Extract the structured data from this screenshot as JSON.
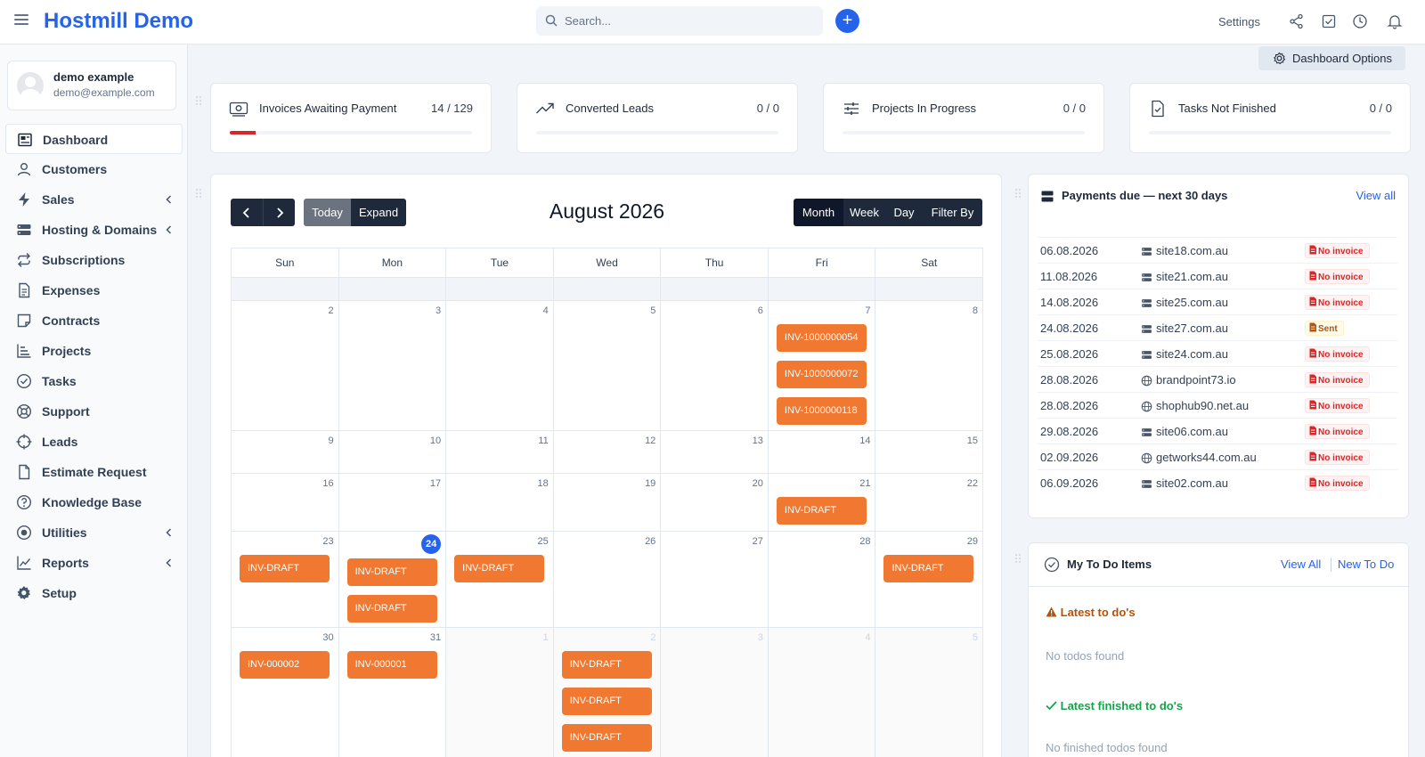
{
  "header": {
    "brand": "Hostmill Demo",
    "search_placeholder": "Search...",
    "add_label": "+",
    "settings_label": "Settings"
  },
  "profile": {
    "name": "demo example",
    "email": "demo@example.com"
  },
  "sidebar": {
    "items": [
      {
        "label": "Dashboard",
        "icon": "dashboard-icon",
        "active": true
      },
      {
        "label": "Customers",
        "icon": "user-icon"
      },
      {
        "label": "Sales",
        "icon": "bolt-icon",
        "chevron": true
      },
      {
        "label": "Hosting & Domains",
        "icon": "server-icon",
        "chevron": true
      },
      {
        "label": "Subscriptions",
        "icon": "repeat-icon"
      },
      {
        "label": "Expenses",
        "icon": "file-text-icon"
      },
      {
        "label": "Contracts",
        "icon": "sticky-note-icon"
      },
      {
        "label": "Projects",
        "icon": "bar-chart-icon"
      },
      {
        "label": "Tasks",
        "icon": "check-circle-icon"
      },
      {
        "label": "Support",
        "icon": "life-buoy-icon"
      },
      {
        "label": "Leads",
        "icon": "crosshair-icon"
      },
      {
        "label": "Estimate Request",
        "icon": "file-icon"
      },
      {
        "label": "Knowledge Base",
        "icon": "help-circle-icon"
      },
      {
        "label": "Utilities",
        "icon": "target-icon",
        "chevron": true
      },
      {
        "label": "Reports",
        "icon": "line-chart-icon",
        "chevron": true
      },
      {
        "label": "Setup",
        "icon": "gear-icon"
      }
    ]
  },
  "dashboard_options_label": "Dashboard Options",
  "stats": [
    {
      "label": "Invoices Awaiting Payment",
      "value": "14 / 129",
      "progress": 0.108
    },
    {
      "label": "Converted Leads",
      "value": "0 / 0",
      "progress": 0
    },
    {
      "label": "Projects In Progress",
      "value": "0 / 0",
      "progress": 0
    },
    {
      "label": "Tasks Not Finished",
      "value": "0 / 0",
      "progress": 0
    }
  ],
  "calendar": {
    "title": "August 2026",
    "today_label": "Today",
    "expand_label": "Expand",
    "views": [
      "Month",
      "Week",
      "Day",
      "Filter By"
    ],
    "weekdays": [
      "Sun",
      "Mon",
      "Tue",
      "Wed",
      "Thu",
      "Fri",
      "Sat"
    ],
    "weeks": [
      [
        {
          "n": "2"
        },
        {
          "n": "3"
        },
        {
          "n": "4"
        },
        {
          "n": "5"
        },
        {
          "n": "6"
        },
        {
          "n": "7",
          "events": [
            "INV-1000000054",
            "INV-1000000072",
            "INV-1000000118"
          ]
        },
        {
          "n": "8"
        }
      ],
      [
        {
          "n": "9"
        },
        {
          "n": "10"
        },
        {
          "n": "11"
        },
        {
          "n": "12"
        },
        {
          "n": "13"
        },
        {
          "n": "14"
        },
        {
          "n": "15"
        }
      ],
      [
        {
          "n": "16"
        },
        {
          "n": "17"
        },
        {
          "n": "18"
        },
        {
          "n": "19"
        },
        {
          "n": "20"
        },
        {
          "n": "21",
          "events": [
            "INV-DRAFT"
          ]
        },
        {
          "n": "22"
        }
      ],
      [
        {
          "n": "23",
          "events": [
            "INV-DRAFT"
          ]
        },
        {
          "n": "24",
          "today": true,
          "events": [
            "INV-DRAFT",
            "INV-DRAFT"
          ]
        },
        {
          "n": "25",
          "events": [
            "INV-DRAFT"
          ]
        },
        {
          "n": "26"
        },
        {
          "n": "27"
        },
        {
          "n": "28"
        },
        {
          "n": "29",
          "events": [
            "INV-DRAFT"
          ]
        }
      ],
      [
        {
          "n": "30",
          "events": [
            "INV-000002"
          ]
        },
        {
          "n": "31",
          "events": [
            "INV-000001"
          ]
        },
        {
          "n": "1",
          "other": true
        },
        {
          "n": "2",
          "other": true,
          "events": [
            "INV-DRAFT",
            "INV-DRAFT",
            "INV-DRAFT"
          ]
        },
        {
          "n": "3",
          "other": true
        },
        {
          "n": "4",
          "other": true
        },
        {
          "n": "5",
          "other": true
        }
      ]
    ]
  },
  "payments": {
    "title": "Payments due — next 30 days",
    "view_all": "View all",
    "rows": [
      {
        "date": "06.08.2026",
        "site": "site18.com.au",
        "icon": "server-icon",
        "status": "No invoice",
        "kind": "noinv"
      },
      {
        "date": "11.08.2026",
        "site": "site21.com.au",
        "icon": "server-icon",
        "status": "No invoice",
        "kind": "noinv"
      },
      {
        "date": "14.08.2026",
        "site": "site25.com.au",
        "icon": "server-icon",
        "status": "No invoice",
        "kind": "noinv"
      },
      {
        "date": "24.08.2026",
        "site": "site27.com.au",
        "icon": "server-icon",
        "status": "Sent",
        "kind": "sent"
      },
      {
        "date": "25.08.2026",
        "site": "site24.com.au",
        "icon": "server-icon",
        "status": "No invoice",
        "kind": "noinv"
      },
      {
        "date": "28.08.2026",
        "site": "brandpoint73.io",
        "icon": "globe-icon",
        "status": "No invoice",
        "kind": "noinv"
      },
      {
        "date": "28.08.2026",
        "site": "shophub90.net.au",
        "icon": "globe-icon",
        "status": "No invoice",
        "kind": "noinv"
      },
      {
        "date": "29.08.2026",
        "site": "site06.com.au",
        "icon": "server-icon",
        "status": "No invoice",
        "kind": "noinv"
      },
      {
        "date": "02.09.2026",
        "site": "getworks44.com.au",
        "icon": "globe-icon",
        "status": "No invoice",
        "kind": "noinv"
      },
      {
        "date": "06.09.2026",
        "site": "site02.com.au",
        "icon": "server-icon",
        "status": "No invoice",
        "kind": "noinv"
      }
    ]
  },
  "todo": {
    "title": "My To Do Items",
    "view_all": "View All",
    "new_todo": "New To Do",
    "latest": "Latest to do's",
    "no_todos": "No todos found",
    "finished": "Latest finished to do's",
    "no_finished": "No finished todos found"
  }
}
